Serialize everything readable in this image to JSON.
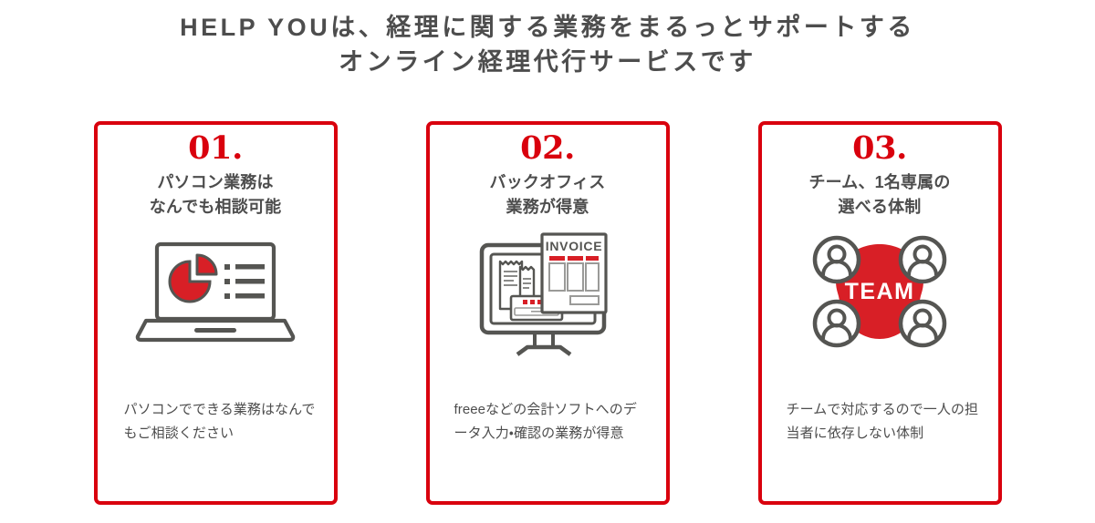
{
  "heading": {
    "line1": "HELP YOUは、経理に関する業務をまるっとサポートする",
    "line2": "オンライン経理代行サービスです"
  },
  "colors": {
    "accent_red": "#d9000d",
    "icon_red": "#d81f26",
    "text_gray": "#4d4d4d",
    "icon_gray": "#555552"
  },
  "cards": [
    {
      "number": "01.",
      "title_line1": "パソコン業務は",
      "title_line2": "なんでも相談可能",
      "icon_name": "laptop-pie-chart-icon",
      "description": "パソコンでできる業務はなんでもご相談ください"
    },
    {
      "number": "02.",
      "title_line1": "バックオフィス",
      "title_line2": "業務が得意",
      "icon_name": "monitor-invoice-icon",
      "icon_label": "INVOICE",
      "description": "freeeなどの会計ソフトへのデータ入力・確認の業務が得意"
    },
    {
      "number": "03.",
      "title_line1": "チーム、1名専属の",
      "title_line2": "選べる体制",
      "icon_name": "team-members-icon",
      "icon_label": "TEAM",
      "description": "チームで対応するので一人の担当者に依存しない体制"
    }
  ]
}
